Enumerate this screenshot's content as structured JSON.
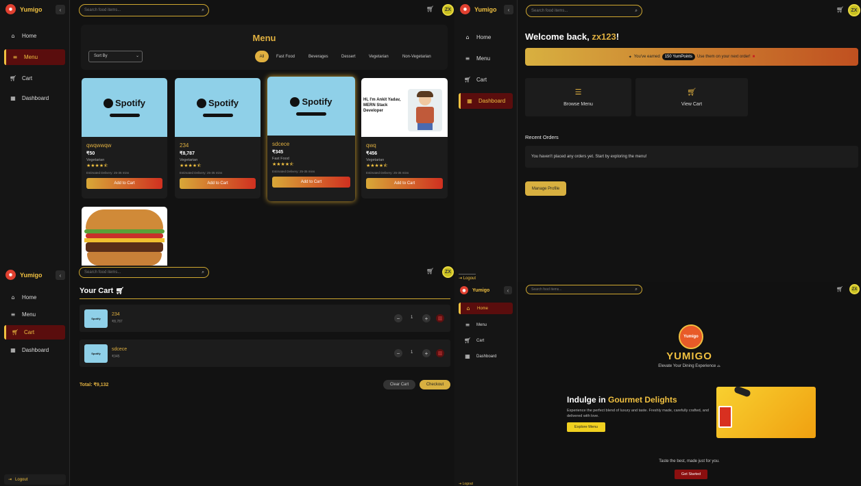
{
  "brand": {
    "name": "Yumigo",
    "full": "YUMIGO",
    "tagline": "Elevate Your Dining Experience",
    "badge_text": "Yumigo"
  },
  "search": {
    "placeholder": "Search food items..."
  },
  "user": {
    "initials": "ZX",
    "name": "zx123"
  },
  "nav": {
    "home": "Home",
    "menu": "Menu",
    "cart": "Cart",
    "dashboard": "Dashboard",
    "logout": "Logout"
  },
  "menu_page": {
    "title": "Menu",
    "sort_label": "Sort By",
    "filters": [
      "All",
      "Fast Food",
      "Beverages",
      "Dessert",
      "Vegetarian",
      "Non-Vegetarian"
    ],
    "add_label": "Add to Cart",
    "items": [
      {
        "name": "qwqwwqw",
        "price": "₹50",
        "category": "Vegetarian",
        "stars": "★★★★⯪",
        "delivery": "Estimated Delivery: 25-35 mins",
        "image": "spotify-banner"
      },
      {
        "name": "234",
        "price": "₹8,787",
        "category": "Vegetarian",
        "stars": "★★★★⯪",
        "delivery": "Estimated Delivery: 25-35 mins",
        "image": "spotify-banner"
      },
      {
        "name": "sdcece",
        "price": "₹345",
        "category": "Fast Food",
        "stars": "★★★★⯪",
        "delivery": "Estimated Delivery: 25-35 mins",
        "image": "spotify-banner"
      },
      {
        "name": "qwq",
        "price": "₹456",
        "category": "Vegetarian",
        "stars": "★★★★⯪",
        "delivery": "Estimated Delivery: 25-35 mins",
        "image": "portfolio-screenshot"
      }
    ],
    "spotify_word": "Spotify",
    "portfolio_text": "Hi, I'm Ankit Yadav, MERN Stack Developer"
  },
  "dashboard": {
    "welcome_prefix": "Welcome back, ",
    "welcome_suffix": "!",
    "points_prefix": "You've earned",
    "points_value": "150 YumPoints",
    "points_suffix": "Use them on your next order!",
    "browse_label": "Browse Menu",
    "view_cart_label": "View Cart",
    "recent_orders_title": "Recent Orders",
    "no_orders_text": "You haven't placed any orders yet. Start by exploring the menu!",
    "manage_profile": "Manage Profile"
  },
  "cart_page": {
    "title": "Your Cart",
    "items": [
      {
        "name": "234",
        "price": "₹8,787",
        "qty": "1"
      },
      {
        "name": "sdcece",
        "price": "₹345",
        "qty": "1"
      }
    ],
    "total": "Total: ₹9,132",
    "clear_label": "Clear Cart",
    "checkout_label": "Checkout"
  },
  "home_page": {
    "hero_prefix": "Indulge in ",
    "hero_highlight": "Gourmet Delights",
    "hero_desc": "Experience the perfect blend of luxury and taste. Freshly made, carefully crafted, and delivered with love.",
    "explore_label": "Explore Menu",
    "bottom_tag": "Taste the best, made just for you.",
    "get_started": "Get Started"
  },
  "colors": {
    "accent": "#f0c040",
    "active_nav": "#5a0d0d",
    "danger": "#8b0f0f",
    "bg": "#141414"
  }
}
